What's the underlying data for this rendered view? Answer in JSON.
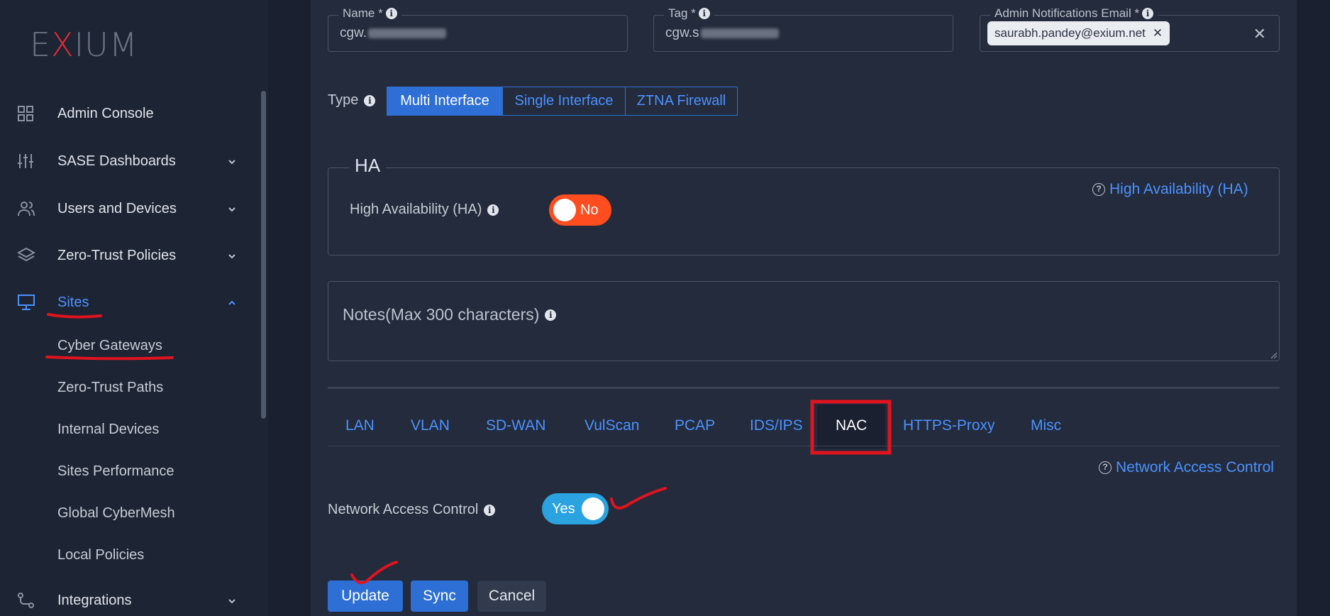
{
  "colors": {
    "accent": "#4c92ff",
    "toggle_off": "#ff4d1f",
    "toggle_on": "#2aa3e0",
    "annotation": "#e0141f"
  },
  "sidebar": {
    "logo": {
      "pre": "E",
      "x": "X",
      "post": "IUM"
    },
    "items": [
      {
        "label": "Admin Console",
        "icon": "grid-icon",
        "expandable": false
      },
      {
        "label": "SASE Dashboards",
        "icon": "sliders-icon",
        "expandable": true
      },
      {
        "label": "Users and Devices",
        "icon": "users-icon",
        "expandable": true
      },
      {
        "label": "Zero-Trust Policies",
        "icon": "layers-icon",
        "expandable": true
      },
      {
        "label": "Sites",
        "icon": "monitor-icon",
        "expandable": true,
        "expanded": true
      },
      {
        "label": "Integrations",
        "icon": "route-icon",
        "expandable": true
      }
    ],
    "sites_children": [
      "Cyber Gateways",
      "Zero-Trust Paths",
      "Internal Devices",
      "Sites Performance",
      "Global CyberMesh",
      "Local Policies"
    ]
  },
  "form": {
    "name": {
      "label": "Name *",
      "value_prefix": "cgw."
    },
    "tag": {
      "label": "Tag *",
      "value_prefix": "cgw.s"
    },
    "admin_email": {
      "label": "Admin Notifications Email *",
      "chip": "saurabh.pandey@exium.net",
      "chip_remove": "✕",
      "clear": "✕"
    },
    "type": {
      "label": "Type",
      "options": [
        "Multi Interface",
        "Single Interface",
        "ZTNA Firewall"
      ],
      "selected": "Multi Interface"
    },
    "ha": {
      "legend": "HA",
      "label": "High Availability (HA)",
      "toggle_text": "No",
      "enabled": false,
      "help_link": "High Availability (HA)"
    },
    "notes": {
      "placeholder": "Notes(Max 300 characters)"
    },
    "tabs": [
      "LAN",
      "VLAN",
      "SD-WAN",
      "VulScan",
      "PCAP",
      "IDS/IPS",
      "NAC",
      "HTTPS-Proxy",
      "Misc"
    ],
    "active_tab": "NAC",
    "nac": {
      "help_link": "Network Access Control",
      "label": "Network Access Control",
      "toggle_text": "Yes",
      "enabled": true
    },
    "buttons": {
      "update": "Update",
      "sync": "Sync",
      "cancel": "Cancel"
    }
  }
}
